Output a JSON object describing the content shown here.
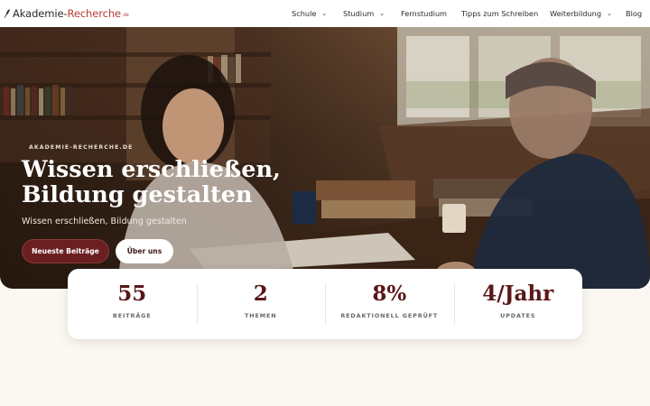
{
  "header": {
    "logo": {
      "main": "Akademie-",
      "accent": "Recherche",
      "tld": ".de"
    },
    "nav": [
      {
        "label": "Schule",
        "has_dropdown": true
      },
      {
        "label": "Studium",
        "has_dropdown": true
      },
      {
        "label": "Fernstudium",
        "has_dropdown": false
      },
      {
        "label": "Tipps zum Schreiben",
        "has_dropdown": false
      },
      {
        "label": "Weiterbildung",
        "has_dropdown": true
      },
      {
        "label": "Blog",
        "has_dropdown": false
      }
    ]
  },
  "hero": {
    "eyebrow": "AKADEMIE-RECHERCHE.DE",
    "title_line1": "Wissen erschließen,",
    "title_line2": "Bildung gestalten",
    "subtitle": "Wissen erschließen, Bildung gestalten",
    "primary_button": "Neueste Beiträge",
    "secondary_button": "Über uns"
  },
  "stats": [
    {
      "value": "55",
      "label": "BEITRÄGE"
    },
    {
      "value": "2",
      "label": "THEMEN"
    },
    {
      "value": "8%",
      "label": "REDAKTIONELL GEPRÜFT"
    },
    {
      "value": "4/Jahr",
      "label": "UPDATES"
    }
  ],
  "colors": {
    "brand": "#b83a36",
    "primary_button": "#6b1f21",
    "stat_value": "#5a1718",
    "page_background": "#fbf7f2"
  }
}
